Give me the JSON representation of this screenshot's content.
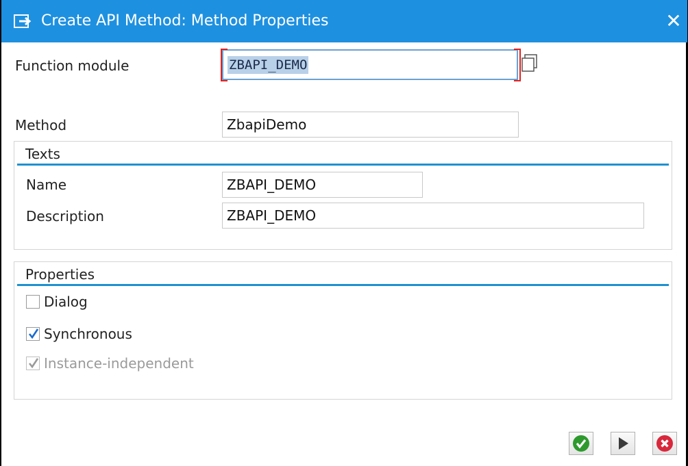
{
  "window": {
    "title": "Create API Method: Method Properties",
    "close_icon": "close-icon",
    "title_icon": "create-icon",
    "accent_color": "#1e90e0"
  },
  "function_module": {
    "label": "Function module",
    "value": "ZBAPI_DEMO",
    "value_help_icon": "value-help-icon"
  },
  "method": {
    "label": "Method",
    "value": "ZbapiDemo"
  },
  "texts_group": {
    "title": "Texts",
    "name_label": "Name",
    "name_value": "ZBAPI_DEMO",
    "description_label": "Description",
    "description_value": "ZBAPI_DEMO"
  },
  "properties_group": {
    "title": "Properties",
    "dialog": {
      "label": "Dialog",
      "checked": false,
      "enabled": true
    },
    "synchronous": {
      "label": "Synchronous",
      "checked": true,
      "enabled": true
    },
    "instance_independent": {
      "label": "Instance-independent",
      "checked": true,
      "enabled": false
    }
  },
  "footer": {
    "confirm_icon": "check-icon",
    "execute_icon": "play-icon",
    "cancel_icon": "cancel-icon",
    "confirm_color": "#2e9a2e",
    "cancel_color": "#d8283c"
  }
}
